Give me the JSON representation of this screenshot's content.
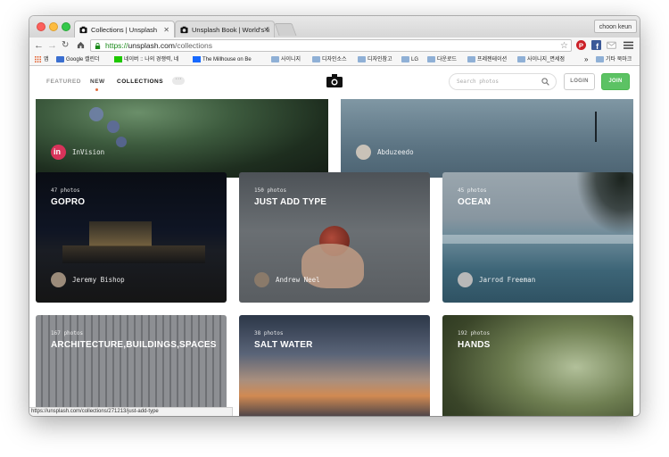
{
  "browser": {
    "tabs": [
      {
        "title": "Collections | Unsplash"
      },
      {
        "title": "Unsplash Book | World's fi"
      }
    ],
    "profile": "choon keun",
    "url": {
      "scheme": "https://",
      "host": "unsplash.com",
      "path": "/collections"
    },
    "bookmarks": [
      "앱",
      "Google 캘린더",
      "네이버 :: 나의 경쟁력, 네",
      "The Millhouse on Be",
      "사이니지",
      "디자인소스",
      "디자인참고",
      "LG",
      "다운로드",
      "프레젠테이션",
      "사이니지_면세점",
      "기타 북마크"
    ],
    "bookmarks_more": "»",
    "status_url": "https://unsplash.com/collections/271213/just-add-type"
  },
  "nav": {
    "featured": "FEATURED",
    "new": "NEW",
    "collections": "COLLECTIONS",
    "more": "···",
    "search_placeholder": "Search photos",
    "login": "LOGIN",
    "join": "JOIN"
  },
  "collections": [
    {
      "author": "InVision"
    },
    {
      "author": "Abduzeedo"
    },
    {
      "count": "47 photos",
      "title": "GOPRO",
      "author": "Jeremy Bishop"
    },
    {
      "count": "150 photos",
      "title": "JUST ADD TYPE",
      "author": "Andrew Neel"
    },
    {
      "count": "45 photos",
      "title": "OCEAN",
      "author": "Jarrod Freeman"
    },
    {
      "count": "167 photos",
      "title": "ARCHITECTURE,BUILDINGS,SPACES"
    },
    {
      "count": "38 photos",
      "title": "SALT WATER"
    },
    {
      "count": "192 photos",
      "title": "HANDS"
    }
  ],
  "icons": {
    "camera_logo": "camera-icon",
    "search": "search-icon",
    "back": "back-arrow-icon",
    "forward": "forward-arrow-icon",
    "reload": "reload-icon",
    "home": "home-icon",
    "star": "star-icon",
    "menu": "hamburger-menu-icon"
  },
  "colors": {
    "join_green": "#5cc264",
    "https_green": "#1a8a1a",
    "new_dot": "#e06c3c"
  }
}
